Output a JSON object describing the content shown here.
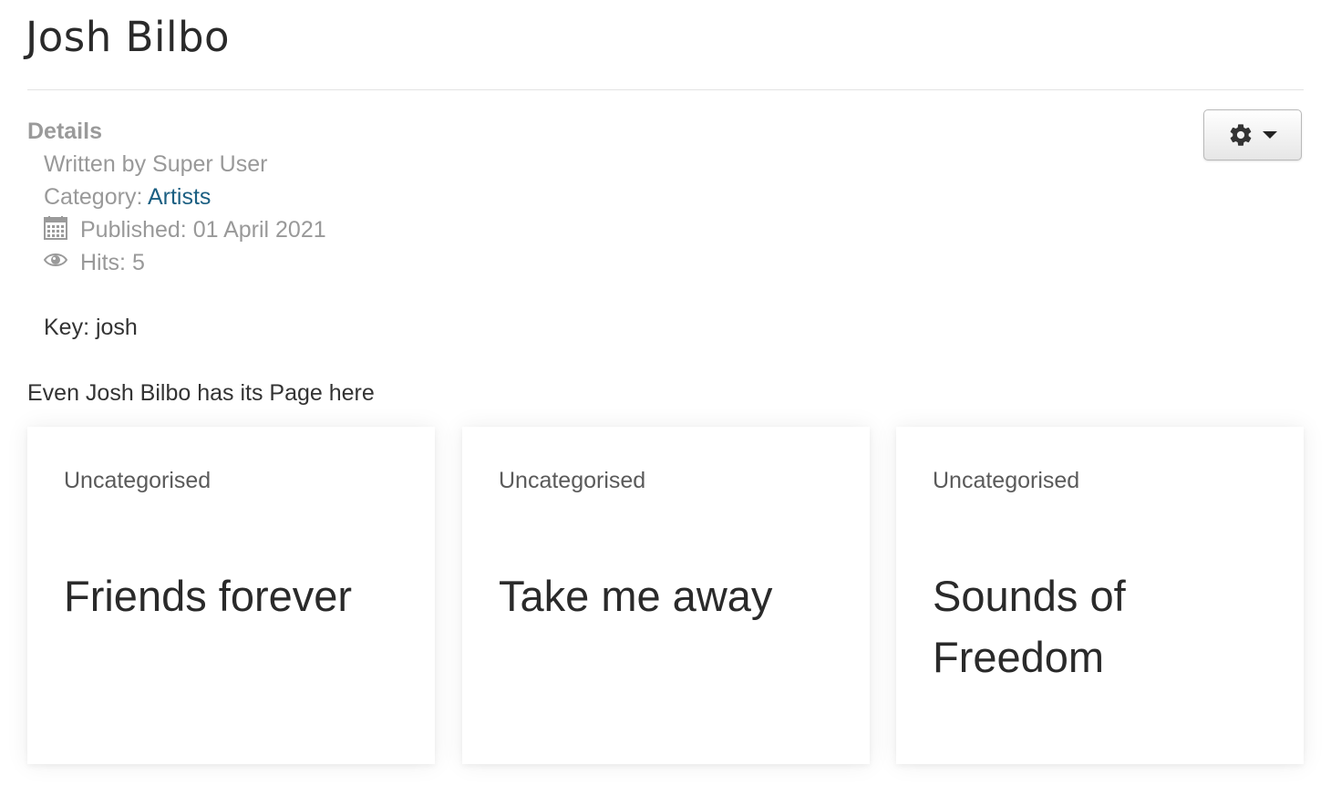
{
  "article": {
    "title": "Josh Bilbo",
    "details_label": "Details",
    "written_by": "Written by Super User",
    "category_prefix": "Category: ",
    "category_name": "Artists",
    "published": "Published: 01 April 2021",
    "hits": "Hits: 5",
    "key_line": "Key: josh",
    "intro": "Even Josh Bilbo has its Page here"
  },
  "toolbar": {
    "gear_icon": "gear-icon",
    "caret_icon": "caret-down-icon"
  },
  "cards": [
    {
      "category": "Uncategorised",
      "title": "Friends forever"
    },
    {
      "category": "Uncategorised",
      "title": "Take me away"
    },
    {
      "category": "Uncategorised",
      "title": "Sounds of Freedom"
    }
  ],
  "colors": {
    "link": "#1b5f82",
    "muted_text": "#999999",
    "body_text": "#333333"
  }
}
